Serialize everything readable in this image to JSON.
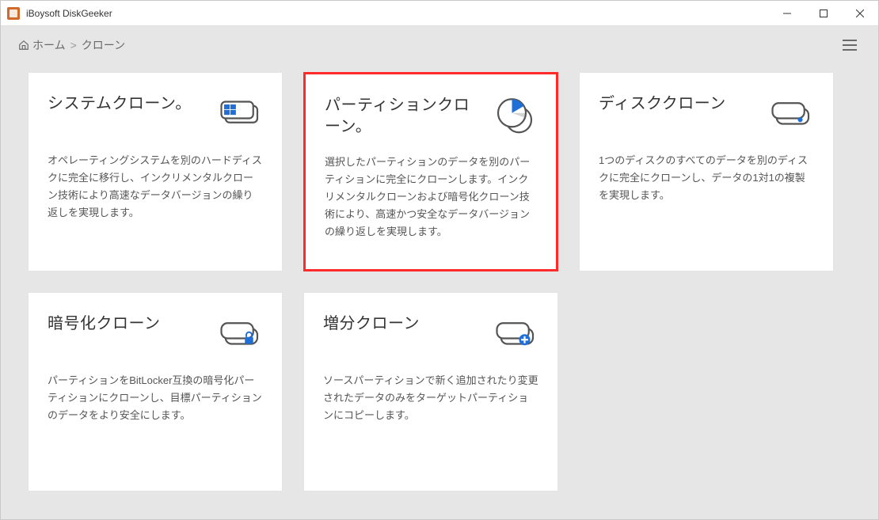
{
  "window": {
    "title": "iBoysoft DiskGeeker"
  },
  "breadcrumb": {
    "home": "ホーム",
    "sep": ">",
    "current": "クローン"
  },
  "cards": {
    "system": {
      "title": "システムクローン。",
      "desc": "オペレーティングシステムを別のハードディスクに完全に移行し、インクリメンタルクローン技術により高速なデータバージョンの繰り返しを実現します。"
    },
    "partition": {
      "title": "パーティションクローン。",
      "desc": "選択したパーティションのデータを別のパーティションに完全にクローンします。インクリメンタルクローンおよび暗号化クローン技術により、高速かつ安全なデータバージョンの繰り返しを実現します。"
    },
    "disk": {
      "title": "ディスククローン",
      "desc": "1つのディスクのすべてのデータを別のディスクに完全にクローンし、データの1対1の複製を実現します。"
    },
    "encrypt": {
      "title": "暗号化クローン",
      "desc": "パーティションをBitLocker互換の暗号化パーティションにクローンし、目標パーティションのデータをより安全にします。"
    },
    "incremental": {
      "title": "増分クローン",
      "desc": "ソースパーティションで新く追加されたり変更されたデータのみをターゲットパーティションにコピーします。"
    }
  },
  "colors": {
    "accent": "#1f6fd6",
    "iconStroke": "#545454",
    "highlight": "#ff2a2a"
  }
}
